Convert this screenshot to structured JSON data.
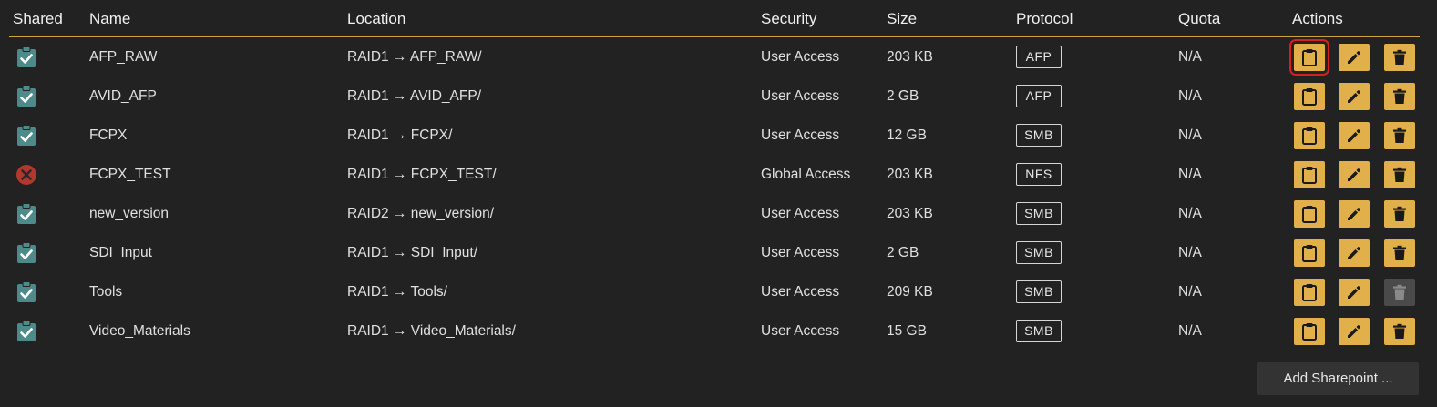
{
  "table": {
    "headers": {
      "shared": "Shared",
      "name": "Name",
      "location": "Location",
      "security": "Security",
      "size": "Size",
      "protocol": "Protocol",
      "quota": "Quota",
      "actions": "Actions"
    },
    "rows": [
      {
        "shared": true,
        "name": "AFP_RAW",
        "location": "RAID1 → AFP_RAW/",
        "security": "User Access",
        "size": "203 KB",
        "protocol": "AFP",
        "quota": "N/A",
        "delete_enabled": true
      },
      {
        "shared": true,
        "name": "AVID_AFP",
        "location": "RAID1 → AVID_AFP/",
        "security": "User Access",
        "size": "2 GB",
        "protocol": "AFP",
        "quota": "N/A",
        "delete_enabled": true
      },
      {
        "shared": true,
        "name": "FCPX",
        "location": "RAID1 → FCPX/",
        "security": "User Access",
        "size": "12 GB",
        "protocol": "SMB",
        "quota": "N/A",
        "delete_enabled": true
      },
      {
        "shared": false,
        "name": "FCPX_TEST",
        "location": "RAID1 → FCPX_TEST/",
        "security": "Global Access",
        "size": "203 KB",
        "protocol": "NFS",
        "quota": "N/A",
        "delete_enabled": true
      },
      {
        "shared": true,
        "name": "new_version",
        "location": "RAID2 → new_version/",
        "security": "User Access",
        "size": "203 KB",
        "protocol": "SMB",
        "quota": "N/A",
        "delete_enabled": true
      },
      {
        "shared": true,
        "name": "SDI_Input",
        "location": "RAID1 → SDI_Input/",
        "security": "User Access",
        "size": "2 GB",
        "protocol": "SMB",
        "quota": "N/A",
        "delete_enabled": true
      },
      {
        "shared": true,
        "name": "Tools",
        "location": "RAID1 → Tools/",
        "security": "User Access",
        "size": "209 KB",
        "protocol": "SMB",
        "quota": "N/A",
        "delete_enabled": false
      },
      {
        "shared": true,
        "name": "Video_Materials",
        "location": "RAID1 → Video_Materials/",
        "security": "User Access",
        "size": "15 GB",
        "protocol": "SMB",
        "quota": "N/A",
        "delete_enabled": true
      }
    ],
    "row_icons": {
      "shared": "clipboard-check-icon",
      "not_shared": "error-circle-icon",
      "copy": "clipboard-icon",
      "edit": "pencil-icon",
      "delete": "trash-icon"
    },
    "highlighted_action": "copy-0"
  },
  "footer": {
    "add_button_label": "Add Sharepoint ..."
  },
  "colors": {
    "background": "#222222",
    "accent": "#e2b04a",
    "divider": "#c9a441",
    "shared_icon": "#4f8a8b",
    "error_icon": "#b2372c",
    "disabled_button": "#4a4a4a",
    "highlight_outline": "#d42020"
  }
}
